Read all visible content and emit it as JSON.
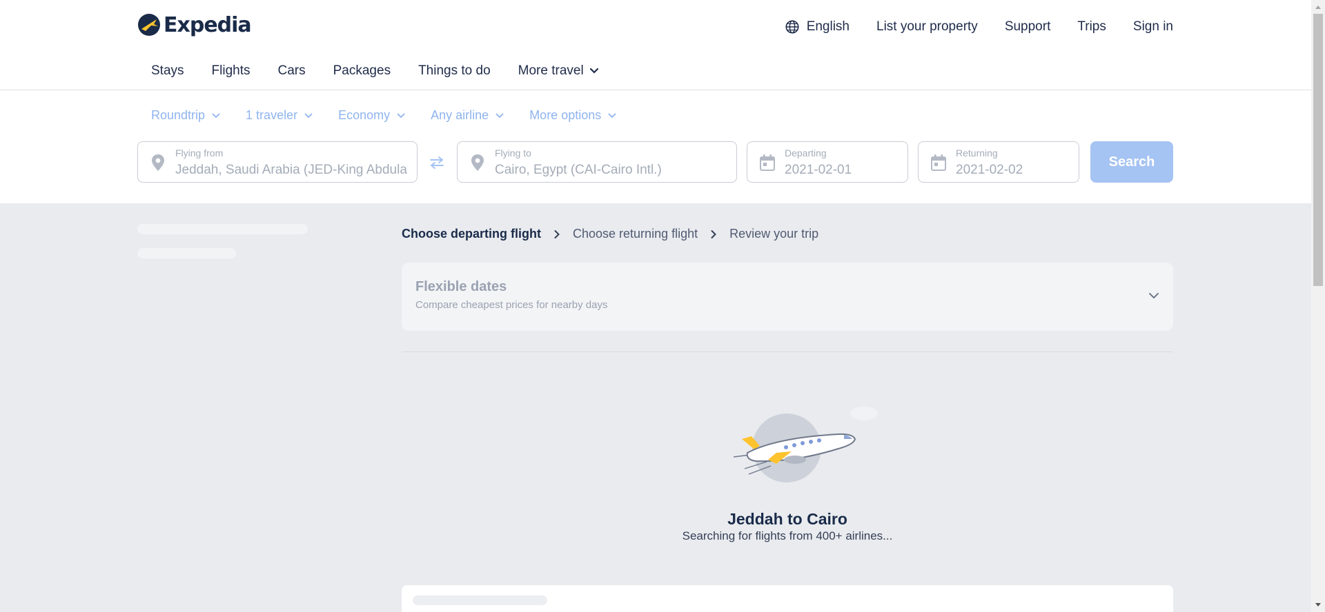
{
  "brand": {
    "name": "Expedia",
    "accent": "#1a2b49",
    "logo_yellow": "#ffc32e"
  },
  "top_links": {
    "language": "English",
    "list_property": "List your property",
    "support": "Support",
    "trips": "Trips",
    "sign_in": "Sign in"
  },
  "nav": {
    "items": [
      "Stays",
      "Flights",
      "Cars",
      "Packages",
      "Things to do"
    ],
    "more": "More travel"
  },
  "filters": {
    "trip_type": "Roundtrip",
    "travelers": "1 traveler",
    "cabin": "Economy",
    "airline": "Any airline",
    "more_options": "More options"
  },
  "search": {
    "from_label": "Flying from",
    "from_value": "Jeddah, Saudi Arabia (JED-King Abdulaziz Intl.)",
    "to_label": "Flying to",
    "to_value": "Cairo, Egypt (CAI-Cairo Intl.)",
    "depart_label": "Departing",
    "depart_value": "2021-02-01",
    "return_label": "Returning",
    "return_value": "2021-02-02",
    "button": "Search",
    "button_color": "#a5c3f3"
  },
  "breadcrumb": {
    "step1": "Choose departing flight",
    "step2": "Choose returning flight",
    "step3": "Review your trip"
  },
  "flexible": {
    "title": "Flexible dates",
    "subtitle": "Compare cheapest prices for nearby days"
  },
  "loading": {
    "route": "Jeddah to Cairo",
    "message": "Searching for flights from 400+ airlines..."
  },
  "icons": {
    "language": "globe-icon",
    "more_travel": "chevron-down-icon",
    "location": "map-pin-icon",
    "swap": "swap-arrows-icon",
    "calendar": "calendar-icon",
    "breadcrumb_separator": "chevron-right-icon",
    "illustration": "airplane-illustration"
  }
}
